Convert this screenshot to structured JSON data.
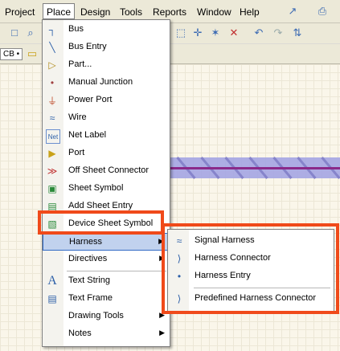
{
  "menubar": {
    "items": [
      "Project",
      "Place",
      "Design",
      "Tools",
      "Reports",
      "Window",
      "Help"
    ]
  },
  "toolbar2": {
    "left_text": "CB •"
  },
  "place_menu": {
    "items": [
      {
        "label": "Bus",
        "icon": "bus-icon",
        "glyph": "┐"
      },
      {
        "label": "Bus Entry",
        "icon": "bus-entry-icon",
        "glyph": "╲"
      },
      {
        "label": "Part...",
        "icon": "part-icon",
        "glyph": "▷"
      },
      {
        "label": "Manual Junction",
        "icon": "junction-icon",
        "glyph": "•"
      },
      {
        "label": "Power Port",
        "icon": "power-port-icon",
        "glyph": "⏚"
      },
      {
        "label": "Wire",
        "icon": "wire-icon",
        "glyph": "≈"
      },
      {
        "label": "Net Label",
        "icon": "net-label-icon",
        "glyph": "Net"
      },
      {
        "label": "Port",
        "icon": "port-icon",
        "glyph": "▶"
      },
      {
        "label": "Off Sheet Connector",
        "icon": "off-sheet-connector-icon",
        "glyph": "≫"
      },
      {
        "label": "Sheet Symbol",
        "icon": "sheet-symbol-icon",
        "glyph": "▣"
      },
      {
        "label": "Add Sheet Entry",
        "icon": "sheet-entry-icon",
        "glyph": "▤"
      },
      {
        "label": "Device Sheet Symbol",
        "icon": "device-sheet-symbol-icon",
        "glyph": "▧"
      },
      {
        "label": "Harness",
        "icon": "",
        "glyph": ""
      },
      {
        "label": "Directives",
        "icon": "",
        "glyph": ""
      },
      {
        "label": "Text String",
        "icon": "text-string-icon",
        "glyph": "A"
      },
      {
        "label": "Text Frame",
        "icon": "text-frame-icon",
        "glyph": "▤"
      },
      {
        "label": "Drawing Tools",
        "icon": "",
        "glyph": ""
      },
      {
        "label": "Notes",
        "icon": "",
        "glyph": ""
      }
    ]
  },
  "harness_submenu": {
    "items": [
      {
        "label": "Signal Harness",
        "icon": "signal-harness-icon",
        "glyph": "≈"
      },
      {
        "label": "Harness Connector",
        "icon": "harness-connector-icon",
        "glyph": "⟩"
      },
      {
        "label": "Harness Entry",
        "icon": "harness-entry-icon",
        "glyph": "•"
      },
      {
        "label": "Predefined Harness Connector",
        "icon": "predefined-harness-connector-icon",
        "glyph": "⟩"
      }
    ]
  },
  "arrow": "▶",
  "colors": {
    "highlight": "#c1d2ee",
    "callout": "#f04a1a"
  }
}
